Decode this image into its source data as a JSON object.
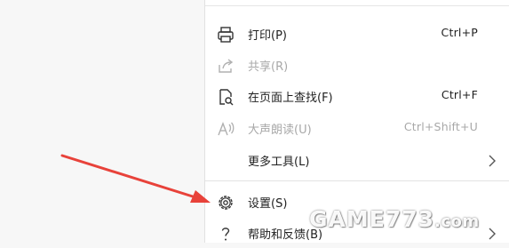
{
  "menu": {
    "items": [
      {
        "label": "打印(P)",
        "shortcut": "Ctrl+P",
        "icon": "printer-icon",
        "disabled": false
      },
      {
        "label": "共享(R)",
        "shortcut": "",
        "icon": "share-icon",
        "disabled": true
      },
      {
        "label": "在页面上查找(F)",
        "shortcut": "Ctrl+F",
        "icon": "find-on-page-icon",
        "disabled": false
      },
      {
        "label": "大声朗读(U)",
        "shortcut": "Ctrl+Shift+U",
        "icon": "read-aloud-icon",
        "disabled": true
      },
      {
        "label": "更多工具(L)",
        "shortcut": "",
        "icon": "chevron-right-icon",
        "disabled": false
      },
      {
        "label": "设置(S)",
        "shortcut": "",
        "icon": "gear-icon",
        "disabled": false
      },
      {
        "label": "帮助和反馈(B)",
        "shortcut": "",
        "icon": "help-icon",
        "disabled": false
      }
    ]
  },
  "annotation": {
    "arrow_color": "#e8423a",
    "target": "settings"
  },
  "watermark": {
    "brand": "GAME773",
    "suffix": ".com"
  }
}
